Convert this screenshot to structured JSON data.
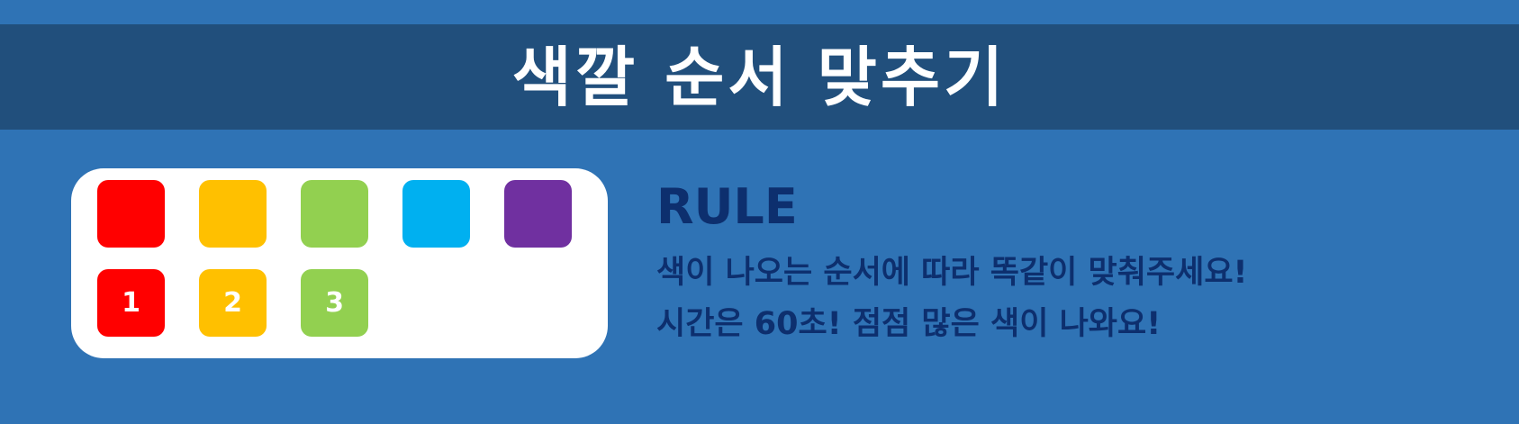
{
  "title": "색깔 순서 맞추기",
  "colors": {
    "background": "#2f73b5",
    "title_bar": "#214f7c",
    "text_dark": "#0d2f6e",
    "card": "#ffffff"
  },
  "palette": [
    {
      "color": "#ff0000",
      "label": ""
    },
    {
      "color": "#ffc000",
      "label": ""
    },
    {
      "color": "#92d050",
      "label": ""
    },
    {
      "color": "#00b0f0",
      "label": ""
    },
    {
      "color": "#7030a0",
      "label": ""
    }
  ],
  "sequence": [
    {
      "color": "#ff0000",
      "label": "1"
    },
    {
      "color": "#ffc000",
      "label": "2"
    },
    {
      "color": "#92d050",
      "label": "3"
    }
  ],
  "rule": {
    "heading": "RULE",
    "line1": "색이 나오는 순서에 따라 똑같이 맞춰주세요!",
    "line2": "시간은 60초! 점점 많은 색이 나와요!"
  }
}
